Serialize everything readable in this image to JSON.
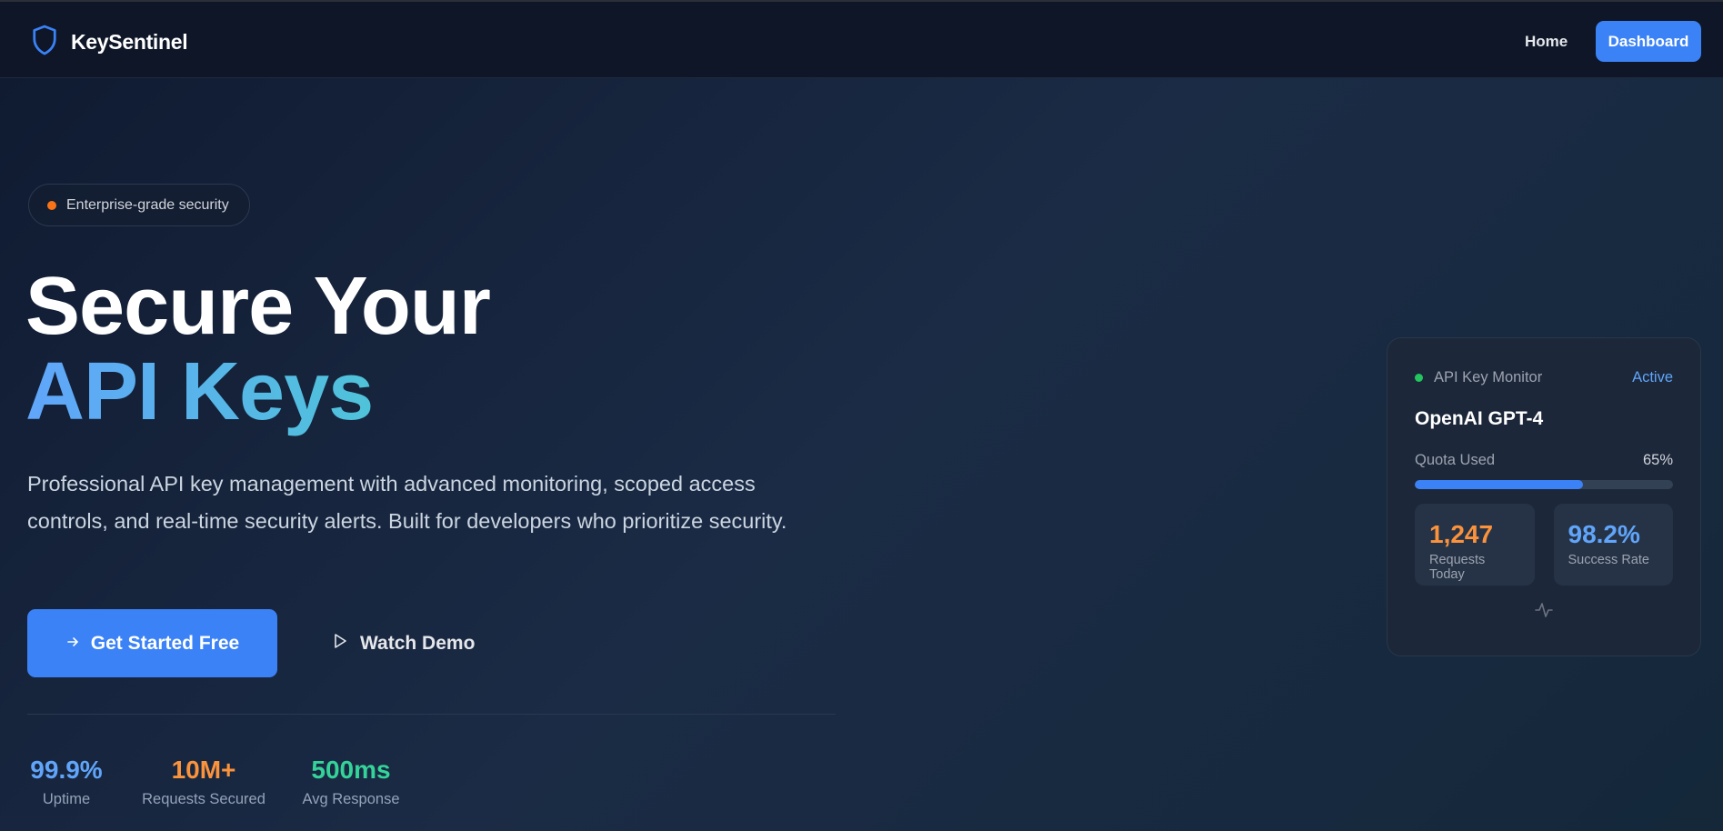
{
  "nav": {
    "brand": "KeySentinel",
    "home": "Home",
    "dashboard": "Dashboard"
  },
  "hero": {
    "badge": "Enterprise-grade security",
    "title_line1": "Secure Your",
    "title_line2": "API Keys",
    "description": "Professional API key management with advanced monitoring, scoped access controls, and real-time security alerts. Built for developers who prioritize security.",
    "cta_primary": "Get Started Free",
    "cta_secondary": "Watch Demo"
  },
  "stats": [
    {
      "value": "99.9%",
      "label": "Uptime",
      "color": "#60a5fa"
    },
    {
      "value": "10M+",
      "label": "Requests Secured",
      "color": "#fb923c"
    },
    {
      "value": "500ms",
      "label": "Avg Response",
      "color": "#34d399"
    }
  ],
  "card": {
    "title": "API Key Monitor",
    "status": "Active",
    "model": "OpenAI GPT-4",
    "quota_label": "Quota Used",
    "quota_value": "65%",
    "quota_percent": 65,
    "tiles": [
      {
        "value": "1,247",
        "label": "Requests Today",
        "color": "#fb923c"
      },
      {
        "value": "98.2%",
        "label": "Success Rate",
        "color": "#60a5fa"
      }
    ]
  },
  "colors": {
    "accent": "#3b82f6",
    "badge_dot": "#f97316",
    "status_dot": "#22c55e"
  }
}
